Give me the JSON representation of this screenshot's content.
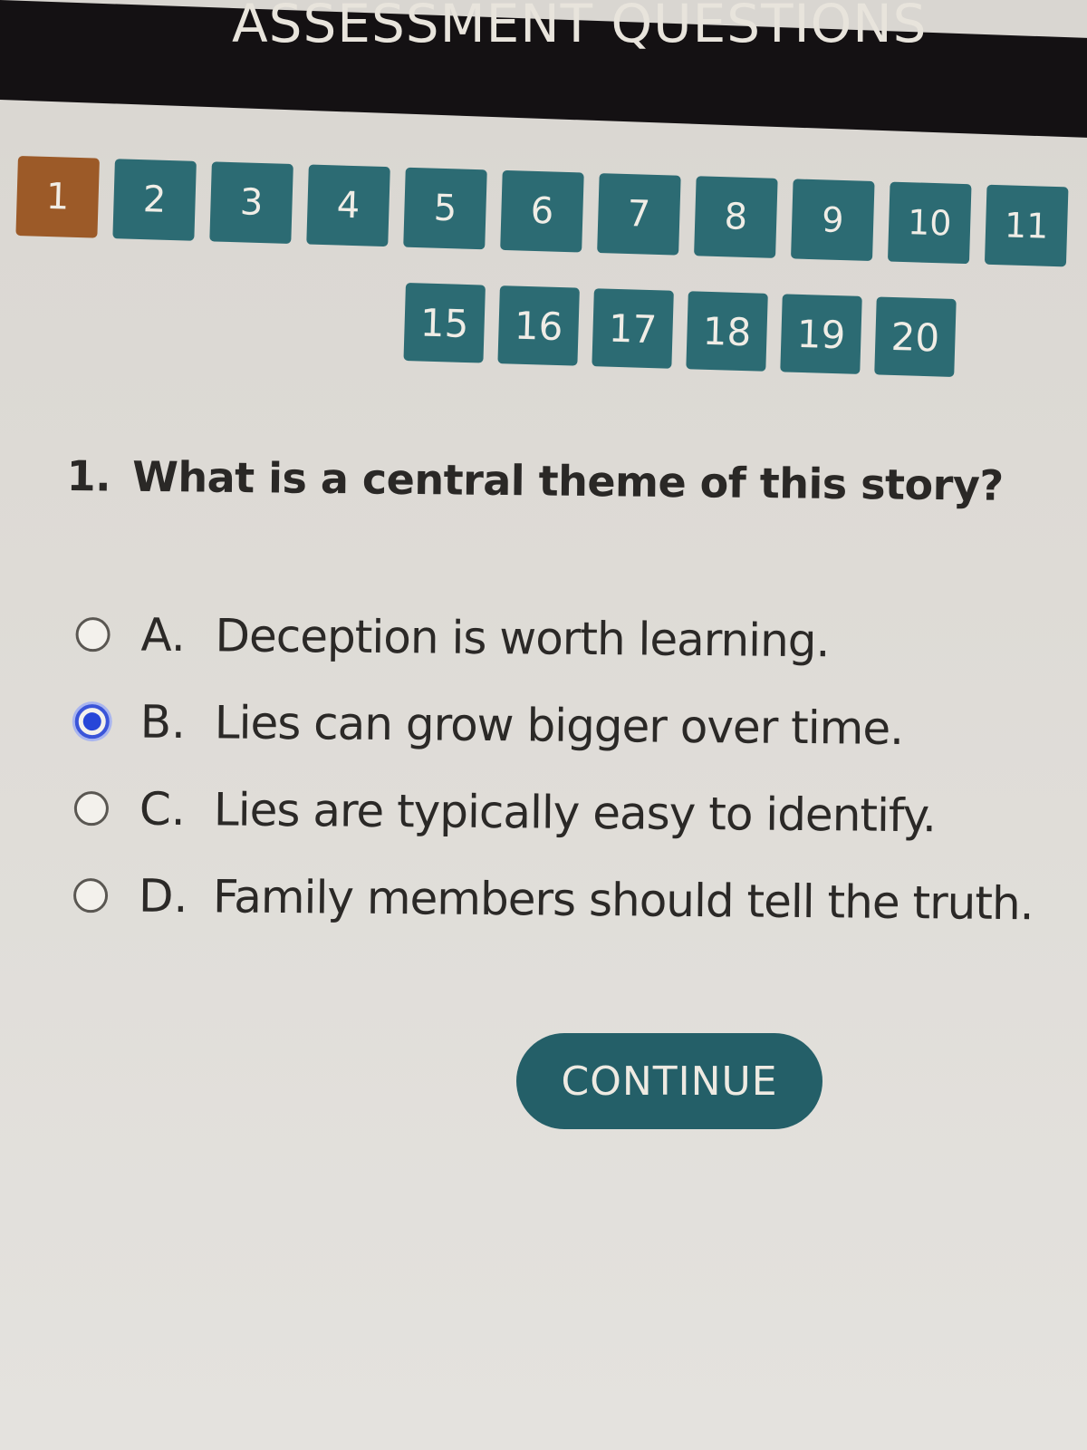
{
  "header": {
    "title": "ASSESSMENT QUESTIONS"
  },
  "question_nav": {
    "current": 1,
    "row1": [
      "1",
      "2",
      "3",
      "4",
      "5",
      "6",
      "7",
      "8",
      "9",
      "10",
      "11"
    ],
    "row2": [
      "15",
      "16",
      "17",
      "18",
      "19",
      "20"
    ],
    "colors": {
      "current": "#9c5a28",
      "default": "#2c6b73"
    }
  },
  "question": {
    "number": "1.",
    "text": "What is a central theme of this story?"
  },
  "options": [
    {
      "letter": "A.",
      "text": "Deception is worth learning.",
      "selected": false
    },
    {
      "letter": "B.",
      "text": "Lies can grow bigger over time.",
      "selected": true
    },
    {
      "letter": "C.",
      "text": "Lies are typically easy to identify.",
      "selected": false
    },
    {
      "letter": "D.",
      "text": "Family members should tell the truth.",
      "selected": false
    }
  ],
  "continue_button": {
    "label": "CONTINUE",
    "color": "#245f68"
  },
  "colors": {
    "radio_selected": "#2746d8"
  }
}
